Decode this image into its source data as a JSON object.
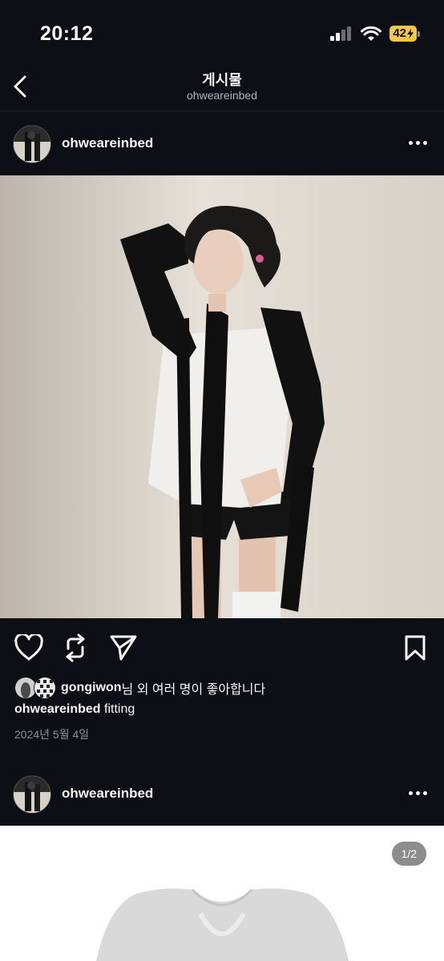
{
  "status_bar": {
    "time": "20:12",
    "battery": "42"
  },
  "header": {
    "title": "게시물",
    "subtitle": "ohweareinbed"
  },
  "post1": {
    "username": "ohweareinbed",
    "likes": {
      "liker": "gongiwon",
      "suffix": "님 외 여러 명이 좋아합니다"
    },
    "caption": {
      "username": "ohweareinbed",
      "text": "fitting"
    },
    "date": "2024년 5월 4일"
  },
  "post2": {
    "username": "ohweareinbed",
    "page_indicator": "1/2"
  },
  "icons": {
    "back": "chevron-left-icon",
    "more": "more-horizontal-icon",
    "like": "heart-icon",
    "repost": "repost-icon",
    "share": "send-icon",
    "save": "bookmark-icon",
    "signal": "signal-icon",
    "wifi": "wifi-icon",
    "battery": "battery-icon"
  },
  "colors": {
    "background": "#0c0f15",
    "text": "#f5f5f5",
    "muted": "#8d9099",
    "battery": "#f6c744"
  }
}
